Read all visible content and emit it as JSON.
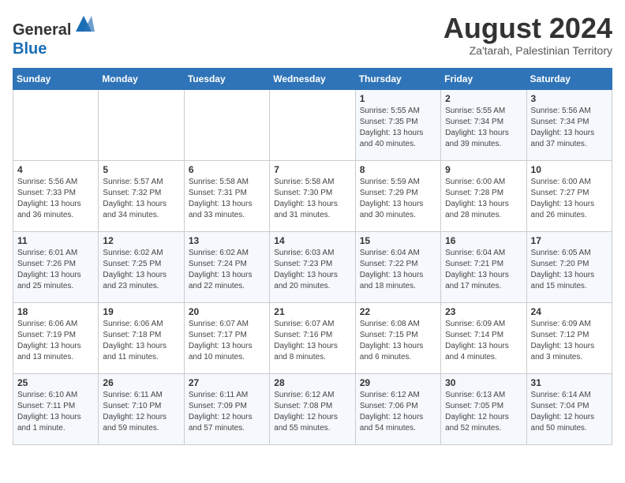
{
  "header": {
    "logo_line1": "General",
    "logo_line2": "Blue",
    "month": "August 2024",
    "location": "Za'tarah, Palestinian Territory"
  },
  "weekdays": [
    "Sunday",
    "Monday",
    "Tuesday",
    "Wednesday",
    "Thursday",
    "Friday",
    "Saturday"
  ],
  "weeks": [
    [
      {
        "day": "",
        "detail": ""
      },
      {
        "day": "",
        "detail": ""
      },
      {
        "day": "",
        "detail": ""
      },
      {
        "day": "",
        "detail": ""
      },
      {
        "day": "1",
        "detail": "Sunrise: 5:55 AM\nSunset: 7:35 PM\nDaylight: 13 hours\nand 40 minutes."
      },
      {
        "day": "2",
        "detail": "Sunrise: 5:55 AM\nSunset: 7:34 PM\nDaylight: 13 hours\nand 39 minutes."
      },
      {
        "day": "3",
        "detail": "Sunrise: 5:56 AM\nSunset: 7:34 PM\nDaylight: 13 hours\nand 37 minutes."
      }
    ],
    [
      {
        "day": "4",
        "detail": "Sunrise: 5:56 AM\nSunset: 7:33 PM\nDaylight: 13 hours\nand 36 minutes."
      },
      {
        "day": "5",
        "detail": "Sunrise: 5:57 AM\nSunset: 7:32 PM\nDaylight: 13 hours\nand 34 minutes."
      },
      {
        "day": "6",
        "detail": "Sunrise: 5:58 AM\nSunset: 7:31 PM\nDaylight: 13 hours\nand 33 minutes."
      },
      {
        "day": "7",
        "detail": "Sunrise: 5:58 AM\nSunset: 7:30 PM\nDaylight: 13 hours\nand 31 minutes."
      },
      {
        "day": "8",
        "detail": "Sunrise: 5:59 AM\nSunset: 7:29 PM\nDaylight: 13 hours\nand 30 minutes."
      },
      {
        "day": "9",
        "detail": "Sunrise: 6:00 AM\nSunset: 7:28 PM\nDaylight: 13 hours\nand 28 minutes."
      },
      {
        "day": "10",
        "detail": "Sunrise: 6:00 AM\nSunset: 7:27 PM\nDaylight: 13 hours\nand 26 minutes."
      }
    ],
    [
      {
        "day": "11",
        "detail": "Sunrise: 6:01 AM\nSunset: 7:26 PM\nDaylight: 13 hours\nand 25 minutes."
      },
      {
        "day": "12",
        "detail": "Sunrise: 6:02 AM\nSunset: 7:25 PM\nDaylight: 13 hours\nand 23 minutes."
      },
      {
        "day": "13",
        "detail": "Sunrise: 6:02 AM\nSunset: 7:24 PM\nDaylight: 13 hours\nand 22 minutes."
      },
      {
        "day": "14",
        "detail": "Sunrise: 6:03 AM\nSunset: 7:23 PM\nDaylight: 13 hours\nand 20 minutes."
      },
      {
        "day": "15",
        "detail": "Sunrise: 6:04 AM\nSunset: 7:22 PM\nDaylight: 13 hours\nand 18 minutes."
      },
      {
        "day": "16",
        "detail": "Sunrise: 6:04 AM\nSunset: 7:21 PM\nDaylight: 13 hours\nand 17 minutes."
      },
      {
        "day": "17",
        "detail": "Sunrise: 6:05 AM\nSunset: 7:20 PM\nDaylight: 13 hours\nand 15 minutes."
      }
    ],
    [
      {
        "day": "18",
        "detail": "Sunrise: 6:06 AM\nSunset: 7:19 PM\nDaylight: 13 hours\nand 13 minutes."
      },
      {
        "day": "19",
        "detail": "Sunrise: 6:06 AM\nSunset: 7:18 PM\nDaylight: 13 hours\nand 11 minutes."
      },
      {
        "day": "20",
        "detail": "Sunrise: 6:07 AM\nSunset: 7:17 PM\nDaylight: 13 hours\nand 10 minutes."
      },
      {
        "day": "21",
        "detail": "Sunrise: 6:07 AM\nSunset: 7:16 PM\nDaylight: 13 hours\nand 8 minutes."
      },
      {
        "day": "22",
        "detail": "Sunrise: 6:08 AM\nSunset: 7:15 PM\nDaylight: 13 hours\nand 6 minutes."
      },
      {
        "day": "23",
        "detail": "Sunrise: 6:09 AM\nSunset: 7:14 PM\nDaylight: 13 hours\nand 4 minutes."
      },
      {
        "day": "24",
        "detail": "Sunrise: 6:09 AM\nSunset: 7:12 PM\nDaylight: 13 hours\nand 3 minutes."
      }
    ],
    [
      {
        "day": "25",
        "detail": "Sunrise: 6:10 AM\nSunset: 7:11 PM\nDaylight: 13 hours\nand 1 minute."
      },
      {
        "day": "26",
        "detail": "Sunrise: 6:11 AM\nSunset: 7:10 PM\nDaylight: 12 hours\nand 59 minutes."
      },
      {
        "day": "27",
        "detail": "Sunrise: 6:11 AM\nSunset: 7:09 PM\nDaylight: 12 hours\nand 57 minutes."
      },
      {
        "day": "28",
        "detail": "Sunrise: 6:12 AM\nSunset: 7:08 PM\nDaylight: 12 hours\nand 55 minutes."
      },
      {
        "day": "29",
        "detail": "Sunrise: 6:12 AM\nSunset: 7:06 PM\nDaylight: 12 hours\nand 54 minutes."
      },
      {
        "day": "30",
        "detail": "Sunrise: 6:13 AM\nSunset: 7:05 PM\nDaylight: 12 hours\nand 52 minutes."
      },
      {
        "day": "31",
        "detail": "Sunrise: 6:14 AM\nSunset: 7:04 PM\nDaylight: 12 hours\nand 50 minutes."
      }
    ]
  ]
}
